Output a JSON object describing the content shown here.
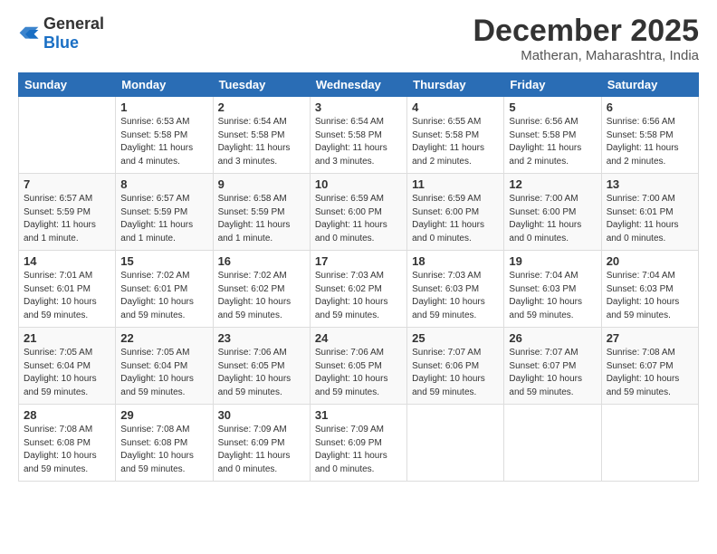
{
  "header": {
    "logo_general": "General",
    "logo_blue": "Blue",
    "month_title": "December 2025",
    "location": "Matheran, Maharashtra, India"
  },
  "weekdays": [
    "Sunday",
    "Monday",
    "Tuesday",
    "Wednesday",
    "Thursday",
    "Friday",
    "Saturday"
  ],
  "weeks": [
    [
      {
        "day": "",
        "info": ""
      },
      {
        "day": "1",
        "info": "Sunrise: 6:53 AM\nSunset: 5:58 PM\nDaylight: 11 hours\nand 4 minutes."
      },
      {
        "day": "2",
        "info": "Sunrise: 6:54 AM\nSunset: 5:58 PM\nDaylight: 11 hours\nand 3 minutes."
      },
      {
        "day": "3",
        "info": "Sunrise: 6:54 AM\nSunset: 5:58 PM\nDaylight: 11 hours\nand 3 minutes."
      },
      {
        "day": "4",
        "info": "Sunrise: 6:55 AM\nSunset: 5:58 PM\nDaylight: 11 hours\nand 2 minutes."
      },
      {
        "day": "5",
        "info": "Sunrise: 6:56 AM\nSunset: 5:58 PM\nDaylight: 11 hours\nand 2 minutes."
      },
      {
        "day": "6",
        "info": "Sunrise: 6:56 AM\nSunset: 5:58 PM\nDaylight: 11 hours\nand 2 minutes."
      }
    ],
    [
      {
        "day": "7",
        "info": "Sunrise: 6:57 AM\nSunset: 5:59 PM\nDaylight: 11 hours\nand 1 minute."
      },
      {
        "day": "8",
        "info": "Sunrise: 6:57 AM\nSunset: 5:59 PM\nDaylight: 11 hours\nand 1 minute."
      },
      {
        "day": "9",
        "info": "Sunrise: 6:58 AM\nSunset: 5:59 PM\nDaylight: 11 hours\nand 1 minute."
      },
      {
        "day": "10",
        "info": "Sunrise: 6:59 AM\nSunset: 6:00 PM\nDaylight: 11 hours\nand 0 minutes."
      },
      {
        "day": "11",
        "info": "Sunrise: 6:59 AM\nSunset: 6:00 PM\nDaylight: 11 hours\nand 0 minutes."
      },
      {
        "day": "12",
        "info": "Sunrise: 7:00 AM\nSunset: 6:00 PM\nDaylight: 11 hours\nand 0 minutes."
      },
      {
        "day": "13",
        "info": "Sunrise: 7:00 AM\nSunset: 6:01 PM\nDaylight: 11 hours\nand 0 minutes."
      }
    ],
    [
      {
        "day": "14",
        "info": "Sunrise: 7:01 AM\nSunset: 6:01 PM\nDaylight: 10 hours\nand 59 minutes."
      },
      {
        "day": "15",
        "info": "Sunrise: 7:02 AM\nSunset: 6:01 PM\nDaylight: 10 hours\nand 59 minutes."
      },
      {
        "day": "16",
        "info": "Sunrise: 7:02 AM\nSunset: 6:02 PM\nDaylight: 10 hours\nand 59 minutes."
      },
      {
        "day": "17",
        "info": "Sunrise: 7:03 AM\nSunset: 6:02 PM\nDaylight: 10 hours\nand 59 minutes."
      },
      {
        "day": "18",
        "info": "Sunrise: 7:03 AM\nSunset: 6:03 PM\nDaylight: 10 hours\nand 59 minutes."
      },
      {
        "day": "19",
        "info": "Sunrise: 7:04 AM\nSunset: 6:03 PM\nDaylight: 10 hours\nand 59 minutes."
      },
      {
        "day": "20",
        "info": "Sunrise: 7:04 AM\nSunset: 6:03 PM\nDaylight: 10 hours\nand 59 minutes."
      }
    ],
    [
      {
        "day": "21",
        "info": "Sunrise: 7:05 AM\nSunset: 6:04 PM\nDaylight: 10 hours\nand 59 minutes."
      },
      {
        "day": "22",
        "info": "Sunrise: 7:05 AM\nSunset: 6:04 PM\nDaylight: 10 hours\nand 59 minutes."
      },
      {
        "day": "23",
        "info": "Sunrise: 7:06 AM\nSunset: 6:05 PM\nDaylight: 10 hours\nand 59 minutes."
      },
      {
        "day": "24",
        "info": "Sunrise: 7:06 AM\nSunset: 6:05 PM\nDaylight: 10 hours\nand 59 minutes."
      },
      {
        "day": "25",
        "info": "Sunrise: 7:07 AM\nSunset: 6:06 PM\nDaylight: 10 hours\nand 59 minutes."
      },
      {
        "day": "26",
        "info": "Sunrise: 7:07 AM\nSunset: 6:07 PM\nDaylight: 10 hours\nand 59 minutes."
      },
      {
        "day": "27",
        "info": "Sunrise: 7:08 AM\nSunset: 6:07 PM\nDaylight: 10 hours\nand 59 minutes."
      }
    ],
    [
      {
        "day": "28",
        "info": "Sunrise: 7:08 AM\nSunset: 6:08 PM\nDaylight: 10 hours\nand 59 minutes."
      },
      {
        "day": "29",
        "info": "Sunrise: 7:08 AM\nSunset: 6:08 PM\nDaylight: 10 hours\nand 59 minutes."
      },
      {
        "day": "30",
        "info": "Sunrise: 7:09 AM\nSunset: 6:09 PM\nDaylight: 11 hours\nand 0 minutes."
      },
      {
        "day": "31",
        "info": "Sunrise: 7:09 AM\nSunset: 6:09 PM\nDaylight: 11 hours\nand 0 minutes."
      },
      {
        "day": "",
        "info": ""
      },
      {
        "day": "",
        "info": ""
      },
      {
        "day": "",
        "info": ""
      }
    ]
  ]
}
